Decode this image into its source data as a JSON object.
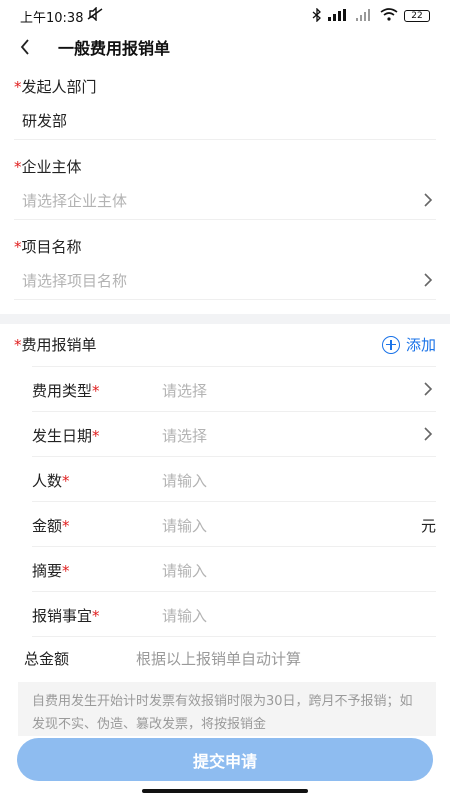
{
  "status_bar": {
    "time": "上午10:38",
    "battery": "22"
  },
  "nav": {
    "title": "一般费用报销单"
  },
  "fields": {
    "department": {
      "label": "发起人部门",
      "value": "研发部"
    },
    "entity": {
      "label": "企业主体",
      "placeholder": "请选择企业主体"
    },
    "project": {
      "label": "项目名称",
      "placeholder": "请选择项目名称"
    }
  },
  "expense_section": {
    "label": "费用报销单",
    "add_label": "添加",
    "rows": [
      {
        "label": "费用类型",
        "placeholder": "请选择",
        "suffix": ""
      },
      {
        "label": "发生日期",
        "placeholder": "请选择",
        "suffix": ""
      },
      {
        "label": "人数",
        "placeholder": "请输入",
        "suffix": ""
      },
      {
        "label": "金额",
        "placeholder": "请输入",
        "suffix": "元"
      },
      {
        "label": "摘要",
        "placeholder": "请输入",
        "suffix": ""
      },
      {
        "label": "报销事宜",
        "placeholder": "请输入",
        "suffix": ""
      }
    ]
  },
  "total": {
    "label": "总金额",
    "value": "根据以上报销单自动计算"
  },
  "notice": {
    "text": "自费用发生开始计时发票有效报销时限为30日，跨月不予报销；如发现不实、伪造、篡改发票，将按报销金"
  },
  "submit": {
    "label": "提交申请"
  },
  "colors": {
    "accent": "#1a73e8",
    "required": "#e02020",
    "submit_bg": "#8ebcf0"
  }
}
